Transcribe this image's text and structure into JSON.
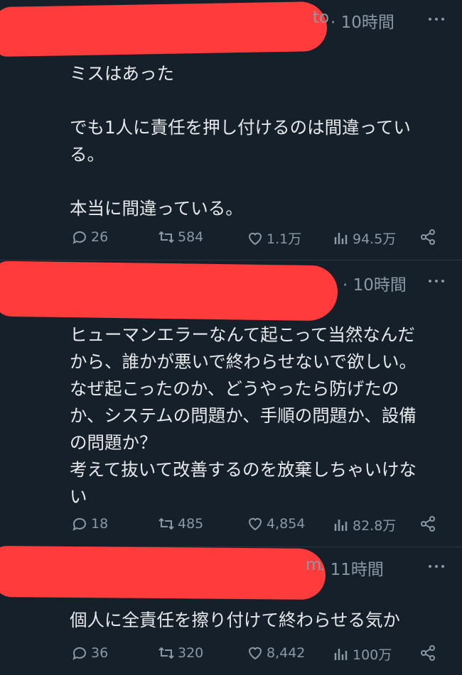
{
  "tweets": [
    {
      "handle_fragment": "to",
      "time": "· 10時間",
      "body": "ミスはあった\n\nでも1人に責任を押し付けるのは間違ってい\nる。\n\n本当に間違っている。",
      "replies": "26",
      "retweets": "584",
      "likes": "1.1万",
      "views": "94.5万"
    },
    {
      "handle_fragment": "",
      "time": "· 10時間",
      "body": "ヒューマンエラーなんて起こって当然なんだ\nから、誰かが悪いで終わらせないで欲しい。\nなぜ起こったのか、どうやったら防げたの\nか、システムの問題か、手順の問題か、設備\nの問題か？\n考えて抜いて改善するのを放棄しちゃいけな\nい",
      "replies": "18",
      "retweets": "485",
      "likes": "4,854",
      "views": "82.8万"
    },
    {
      "handle_fragment": "m",
      "time": "· 11時間",
      "body": "個人に全責任を擦り付けて終わらせる気か",
      "replies": "36",
      "retweets": "320",
      "likes": "8,442",
      "views": "100万"
    }
  ],
  "colors": {
    "background": "#15202b",
    "redaction": "#ff3b3b",
    "muted": "#8b98a5",
    "text": "#e7e9ea"
  }
}
